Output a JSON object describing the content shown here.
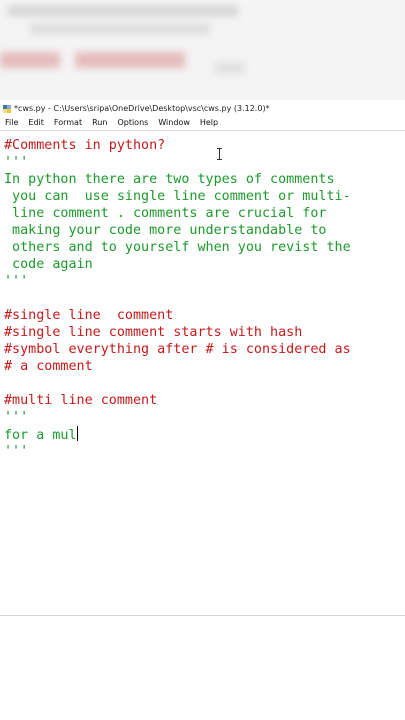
{
  "window": {
    "title": "*cws.py - C:\\Users\\sripa\\OneDrive\\Desktop\\vsc\\cws.py (3.12.0)*"
  },
  "menu": [
    "File",
    "Edit",
    "Format",
    "Run",
    "Options",
    "Window",
    "Help"
  ],
  "editor": {
    "lines": [
      {
        "text": "#Comments in python?",
        "kind": "comment"
      },
      {
        "text": "'''",
        "kind": "string"
      },
      {
        "text": "In python there are two types of comments",
        "kind": "string"
      },
      {
        "text": " you can  use single line comment or multi-",
        "kind": "string"
      },
      {
        "text": " line comment . comments are crucial for",
        "kind": "string"
      },
      {
        "text": " making your code more understandable to",
        "kind": "string"
      },
      {
        "text": " others and to yourself when you revist the",
        "kind": "string"
      },
      {
        "text": " code again",
        "kind": "string"
      },
      {
        "text": "'''",
        "kind": "string"
      },
      {
        "text": "",
        "kind": "blank"
      },
      {
        "text": "#single line  comment",
        "kind": "comment"
      },
      {
        "text": "#single line comment starts with hash",
        "kind": "comment"
      },
      {
        "text": "#symbol everything after # is considered as",
        "kind": "comment"
      },
      {
        "text": "# a comment",
        "kind": "comment"
      },
      {
        "text": "",
        "kind": "blank"
      },
      {
        "text": "#multi line comment",
        "kind": "comment"
      },
      {
        "text": "'''",
        "kind": "string"
      },
      {
        "text": "for a mul",
        "kind": "string"
      },
      {
        "text": "'''",
        "kind": "string"
      }
    ],
    "cursor_line": 17
  },
  "colors": {
    "comment": "#c41a1a",
    "string": "#1d9a2c",
    "background": "#ffffff"
  },
  "icons": {
    "app": "python-idle-icon",
    "pointer": "text-cursor-icon"
  }
}
